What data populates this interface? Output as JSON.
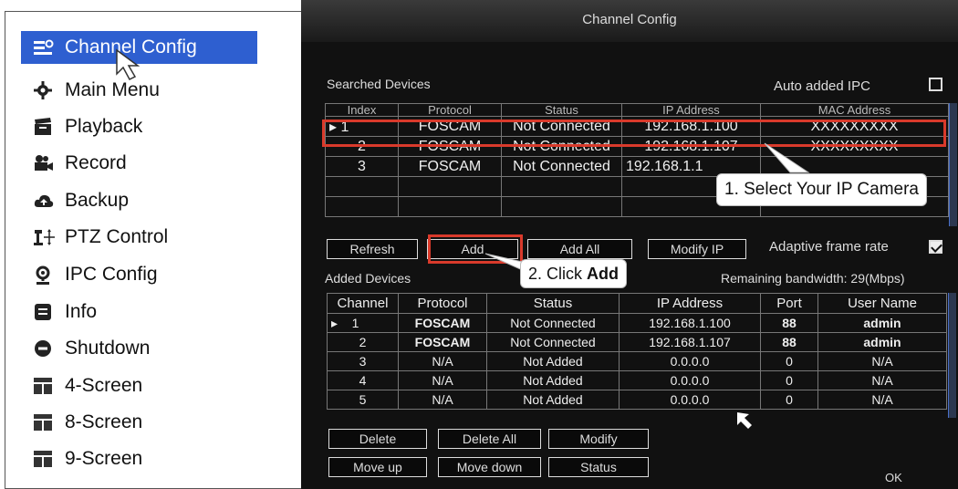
{
  "menu": {
    "items": [
      {
        "label": "Channel Config",
        "icon": "channel-config-icon",
        "active": true
      },
      {
        "label": "Main Menu",
        "icon": "gear-icon"
      },
      {
        "label": "Playback",
        "icon": "clapperboard-icon"
      },
      {
        "label": "Record",
        "icon": "camera-icon"
      },
      {
        "label": "Backup",
        "icon": "cloud-icon"
      },
      {
        "label": "PTZ Control",
        "icon": "ptz-icon"
      },
      {
        "label": "IPC Config",
        "icon": "location-pin-icon"
      },
      {
        "label": "Info",
        "icon": "info-list-icon"
      },
      {
        "label": "Shutdown",
        "icon": "shutdown-icon"
      },
      {
        "label": "4-Screen",
        "icon": "grid-icon"
      },
      {
        "label": "8-Screen",
        "icon": "grid-icon"
      },
      {
        "label": "9-Screen",
        "icon": "grid-icon"
      }
    ]
  },
  "dialog": {
    "title": "Channel Config",
    "searched_label": "Searched Devices",
    "auto_added_label": "Auto added IPC",
    "auto_added_checked": false,
    "searched_table": {
      "headers": [
        "Index",
        "Protocol",
        "Status",
        "IP Address",
        "MAC Address"
      ],
      "rows": [
        [
          "1",
          "FOSCAM",
          "Not Connected",
          "192.168.1.100",
          "XXXXXXXXX"
        ],
        [
          "2",
          "FOSCAM",
          "Not Connected",
          "192.168.1.107",
          "XXXXXXXXX"
        ],
        [
          "3",
          "FOSCAM",
          "Not Connected",
          "192.168.1.1",
          ""
        ],
        [
          "",
          "",
          "",
          "",
          ""
        ],
        [
          "",
          "",
          "",
          "",
          ""
        ]
      ]
    },
    "buttons_row1": {
      "refresh": "Refresh",
      "add": "Add",
      "add_all": "Add All",
      "modify_ip": "Modify IP"
    },
    "adaptive_label": "Adaptive frame rate",
    "adaptive_checked": true,
    "added_label": "Added Devices",
    "remaining_bandwidth": "Remaining bandwidth: 29(Mbps)",
    "added_table": {
      "headers": [
        "Channel",
        "Protocol",
        "Status",
        "IP Address",
        "Port",
        "User Name"
      ],
      "rows": [
        [
          "1",
          "FOSCAM",
          "Not Connected",
          "192.168.1.100",
          "88",
          "admin"
        ],
        [
          "2",
          "FOSCAM",
          "Not Connected",
          "192.168.1.107",
          "88",
          "admin"
        ],
        [
          "3",
          "N/A",
          "Not Added",
          "0.0.0.0",
          "0",
          "N/A"
        ],
        [
          "4",
          "N/A",
          "Not Added",
          "0.0.0.0",
          "0",
          "N/A"
        ],
        [
          "5",
          "N/A",
          "Not Added",
          "0.0.0.0",
          "0",
          "N/A"
        ]
      ]
    },
    "buttons_bottom": {
      "delete": "Delete",
      "delete_all": "Delete All",
      "modify": "Modify",
      "move_up": "Move up",
      "move_down": "Move down",
      "status": "Status",
      "ok": "OK"
    }
  },
  "annotations": {
    "step1_prefix": "1. Select Your IP Camera",
    "step2_prefix": "2. Click ",
    "step2_bold": "Add"
  },
  "colors": {
    "menu_active": "#2e5fd0",
    "highlight": "#d93a2b",
    "dialog_bg": "#111111"
  }
}
